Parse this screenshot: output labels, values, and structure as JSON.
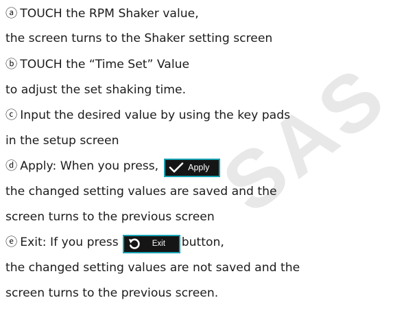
{
  "watermark": "SAS",
  "lines": [
    {
      "marker": "ⓐ",
      "text": "TOUCH the RPM Shaker value,"
    },
    {
      "text": "the screen turns to the Shaker setting screen"
    },
    {
      "marker": "ⓑ",
      "text": "TOUCH the “Time Set” Value"
    },
    {
      "text": "to adjust the set shaking time."
    },
    {
      "marker": "ⓒ",
      "text": "Input the desired value by using the key pads"
    },
    {
      "text": "in the setup screen"
    },
    {
      "marker": "ⓓ",
      "text": "Apply: When you press,"
    },
    {
      "text": "the changed setting values are saved and the"
    },
    {
      "text": "screen turns to the previous screen"
    },
    {
      "marker": "ⓔ",
      "text_before": "Exit: If you press",
      "text_after": "button,"
    },
    {
      "text": "the changed setting values are not saved and the"
    },
    {
      "text": "screen turns to the previous screen."
    }
  ],
  "buttons": {
    "apply": {
      "label": "Apply",
      "icon": "checkmark-icon",
      "border_color": "#16a3b4"
    },
    "exit": {
      "label": "Exit",
      "icon": "undo-arrow-icon",
      "border_color": "#16a3b4"
    }
  }
}
